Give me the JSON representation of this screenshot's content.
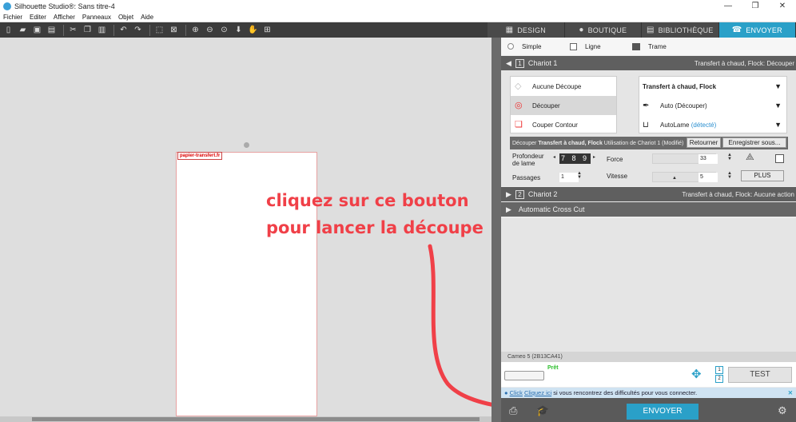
{
  "window": {
    "title": "Silhouette Studio®: Sans titre-4",
    "controls": [
      "—",
      "❐",
      "✕"
    ]
  },
  "menu": [
    "Fichier",
    "Editer",
    "Afficher",
    "Panneaux",
    "Objet",
    "Aide"
  ],
  "toolbar_icons": [
    "new-icon",
    "open-icon",
    "save-icon",
    "print-icon",
    "cut-icon",
    "copy-icon",
    "paste-icon",
    "undo-icon",
    "redo-icon",
    "select-icon",
    "deselect-icon",
    "zoom-in-icon",
    "zoom-out-icon",
    "zoom-fit-icon",
    "move-down-icon",
    "pan-icon",
    "fit-page-icon"
  ],
  "tabs": [
    {
      "label": "DESIGN",
      "icon": "grid-icon",
      "active": false
    },
    {
      "label": "BOUTIQUE",
      "icon": "shop-icon",
      "active": false
    },
    {
      "label": "BIBLIOTHÈQUE",
      "icon": "library-icon",
      "active": false
    },
    {
      "label": "ENVOYER",
      "icon": "send-icon",
      "active": true
    }
  ],
  "canvas": {
    "page_label": "papier-transfert.fr"
  },
  "annotation": {
    "line1": "cliquez sur ce bouton",
    "line2": "pour lancer la découpe"
  },
  "modes": [
    {
      "label": "Simple",
      "active": true
    },
    {
      "label": "Ligne",
      "active": false
    },
    {
      "label": "Trame",
      "active": false
    }
  ],
  "chariot1": {
    "num": "1",
    "label": "Chariot 1",
    "summary": "Transfert à chaud, Flock: Découper"
  },
  "actions": [
    {
      "label": "Aucune Découpe",
      "selected": false
    },
    {
      "label": "Découper",
      "selected": true
    },
    {
      "label": "Couper Contour",
      "selected": false
    }
  ],
  "settings": [
    {
      "label": "Transfert à chaud, Flock",
      "extra": ""
    },
    {
      "label": "Auto (Découper)",
      "extra": ""
    },
    {
      "label": "AutoLame",
      "extra": "(détecté)"
    }
  ],
  "detail": {
    "prefix": "Découper",
    "material": "Transfert à chaud, Flock",
    "suffix": "Utilisation de Chariot 1 (Modifié)",
    "retourner": "Retourner",
    "enregistrer": "Enregistrer sous..."
  },
  "params": {
    "profondeur_label": "Profondeur de lame",
    "profondeur_value": "7 8 9",
    "force_label": "Force",
    "force_value": "33",
    "passages_label": "Passages",
    "passages_value": "1",
    "vitesse_label": "Vitesse",
    "vitesse_value": "5",
    "plus": "PLUS"
  },
  "chariot2": {
    "num": "2",
    "label": "Chariot 2",
    "summary": "Transfert à chaud, Flock: Aucune action"
  },
  "crosscut": {
    "label": "Automatic Cross Cut"
  },
  "device": {
    "name": "Cameo 5 (2B13CA41)",
    "status": "Prêt",
    "test": "TEST",
    "stack": [
      "1",
      "2"
    ]
  },
  "info": {
    "link1": "Click",
    "link2": "Cliquez ici",
    "text": "si vous rencontrez des difficultés pour vous connecter."
  },
  "send": {
    "label": "ENVOYER"
  },
  "colors": {
    "accent": "#2aa0c8",
    "annotation": "#f04048",
    "ready": "#2bbf2b"
  }
}
